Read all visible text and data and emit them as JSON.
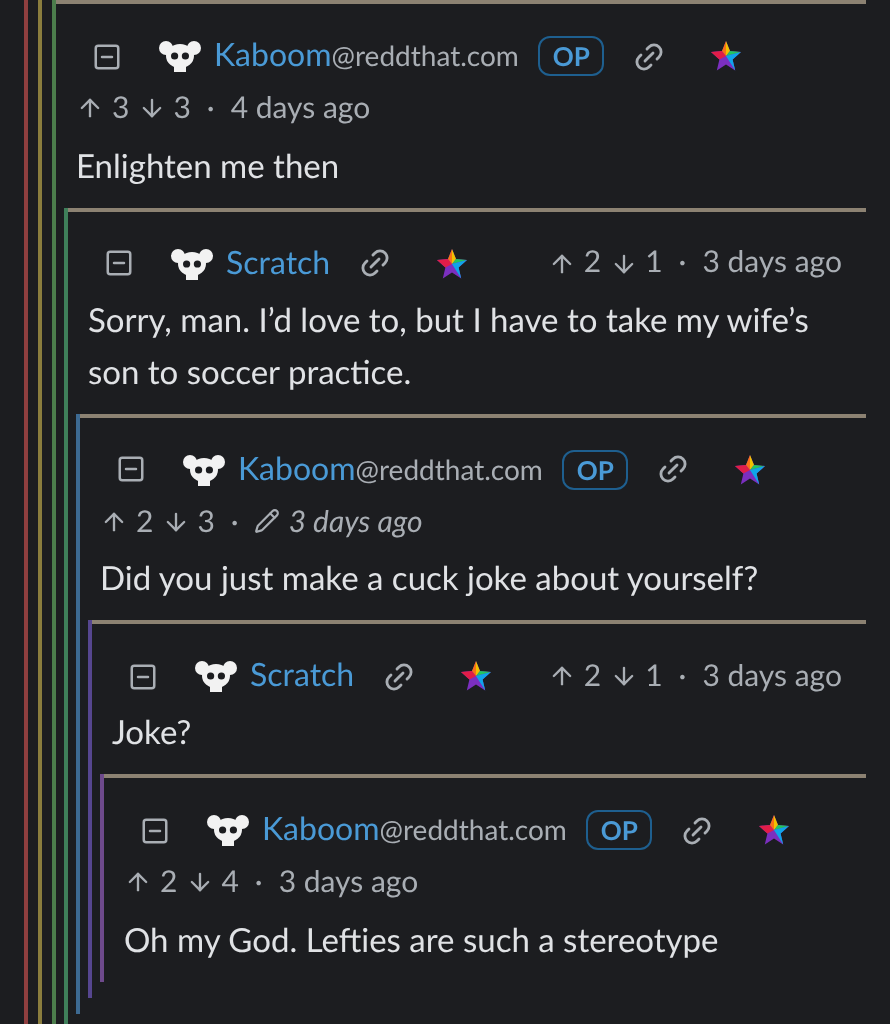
{
  "thread_lines": [
    {
      "color": "#8f3f3f"
    },
    {
      "color": "#8a7d3e"
    }
  ],
  "comments": [
    {
      "kind": "stacked",
      "color": "#4c7d4c",
      "user": "Kaboom",
      "instance": "@reddthat.com",
      "badge": "OP",
      "upvotes": "3",
      "downvotes": "3",
      "separator": "·",
      "time": "4 days ago",
      "body": "Enlighten me then",
      "children": [
        {
          "kind": "inline",
          "color": "#3f7f5a",
          "user": "Scratch",
          "upvotes": "2",
          "downvotes": "1",
          "separator": "·",
          "time": "3 days ago",
          "body": "Sorry, man. I’d love to, but I have to take my wife’s son to soccer practice.",
          "children": [
            {
              "kind": "stacked",
              "color": "#3d6a92",
              "user": "Kaboom",
              "instance": "@reddthat.com",
              "badge": "OP",
              "upvotes": "2",
              "downvotes": "3",
              "separator": "·",
              "time": "3 days ago",
              "edited": true,
              "body": "Did you just make a cuck joke about yourself?",
              "children": [
                {
                  "kind": "inline",
                  "color": "#56468f",
                  "user": "Scratch",
                  "upvotes": "2",
                  "downvotes": "1",
                  "separator": "·",
                  "time": "3 days ago",
                  "body": "Joke?",
                  "children": [
                    {
                      "kind": "stacked",
                      "color": "#6e4a8c",
                      "user": "Kaboom",
                      "instance": "@reddthat.com",
                      "badge": "OP",
                      "upvotes": "2",
                      "downvotes": "4",
                      "separator": "·",
                      "time": "3 days ago",
                      "body": "Oh my God. Lefties are such a stereotype"
                    }
                  ]
                }
              ]
            }
          ]
        }
      ]
    }
  ]
}
